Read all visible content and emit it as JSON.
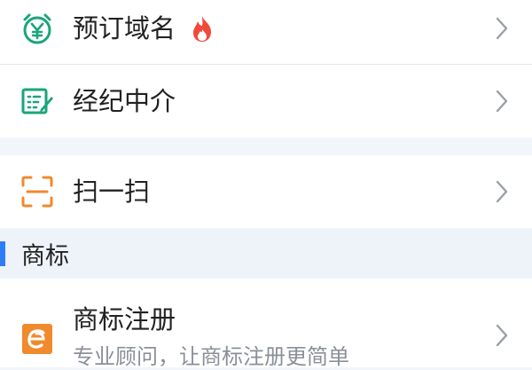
{
  "menu": {
    "items": [
      {
        "label": "预订域名",
        "icon": "yen-alarm-icon",
        "hot": true
      },
      {
        "label": "经纪中介",
        "icon": "edit-list-icon"
      },
      {
        "label": "扫一扫",
        "icon": "scan-icon"
      }
    ]
  },
  "trademark_section": {
    "title": "商标",
    "items": [
      {
        "label": "商标注册",
        "subtitle": "专业顾问，让商标注册更简单",
        "icon": "trademark-e-icon"
      }
    ]
  },
  "colors": {
    "green": "#1aa57a",
    "orange": "#f08a2c",
    "blue_accent": "#2f7df6",
    "fire_red": "#f04a3a"
  }
}
